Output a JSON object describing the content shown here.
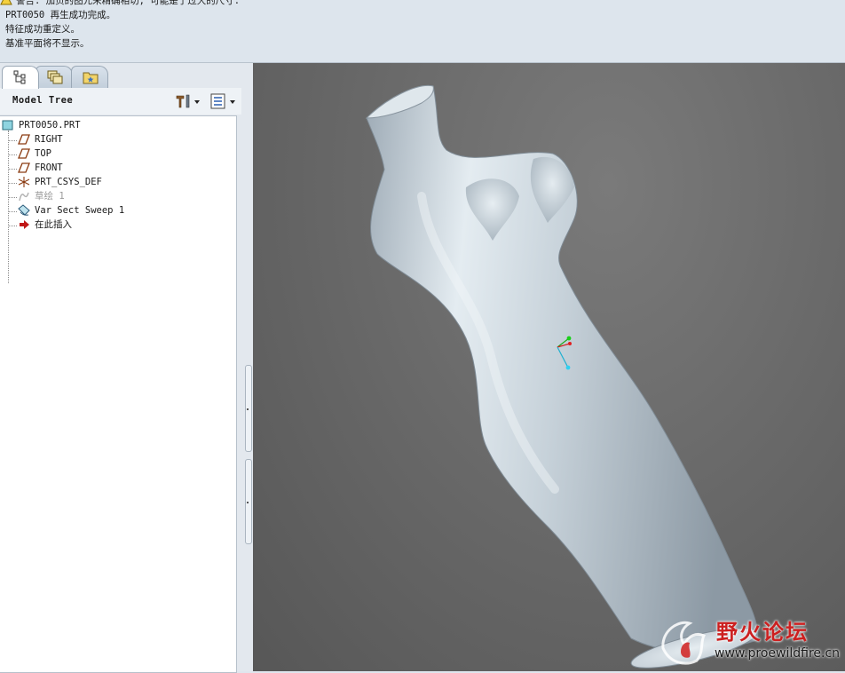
{
  "messages": [
    "警告: 加页的图元未精确相切, 可能是了过大的尺寸.",
    "PRT0050 再生成功完成。",
    "特征成功重定义。",
    "基准平面将不显示。"
  ],
  "model_tree": {
    "title": "Model Tree",
    "tabs": [
      "model-tree-tab",
      "layers-tab",
      "favorites-tab"
    ],
    "nodes": [
      {
        "label": "PRT0050.PRT",
        "icon": "part-icon"
      },
      {
        "label": "RIGHT",
        "icon": "datum-plane-icon"
      },
      {
        "label": "TOP",
        "icon": "datum-plane-icon"
      },
      {
        "label": "FRONT",
        "icon": "datum-plane-icon"
      },
      {
        "label": "PRT_CSYS_DEF",
        "icon": "csys-icon"
      },
      {
        "label": "草绘 1",
        "icon": "sketch-icon"
      },
      {
        "label": "Var Sect Sweep 1",
        "icon": "sweep-icon"
      },
      {
        "label": "在此插入",
        "icon": "insert-arrow-icon"
      }
    ]
  },
  "watermark": {
    "name": "野火论坛",
    "url": "www.proewildfire.cn"
  },
  "colors": {
    "viewport_bg": "#6a6a6a",
    "model_surface": "#c9d4dc",
    "insert_arrow": "#c01818"
  }
}
